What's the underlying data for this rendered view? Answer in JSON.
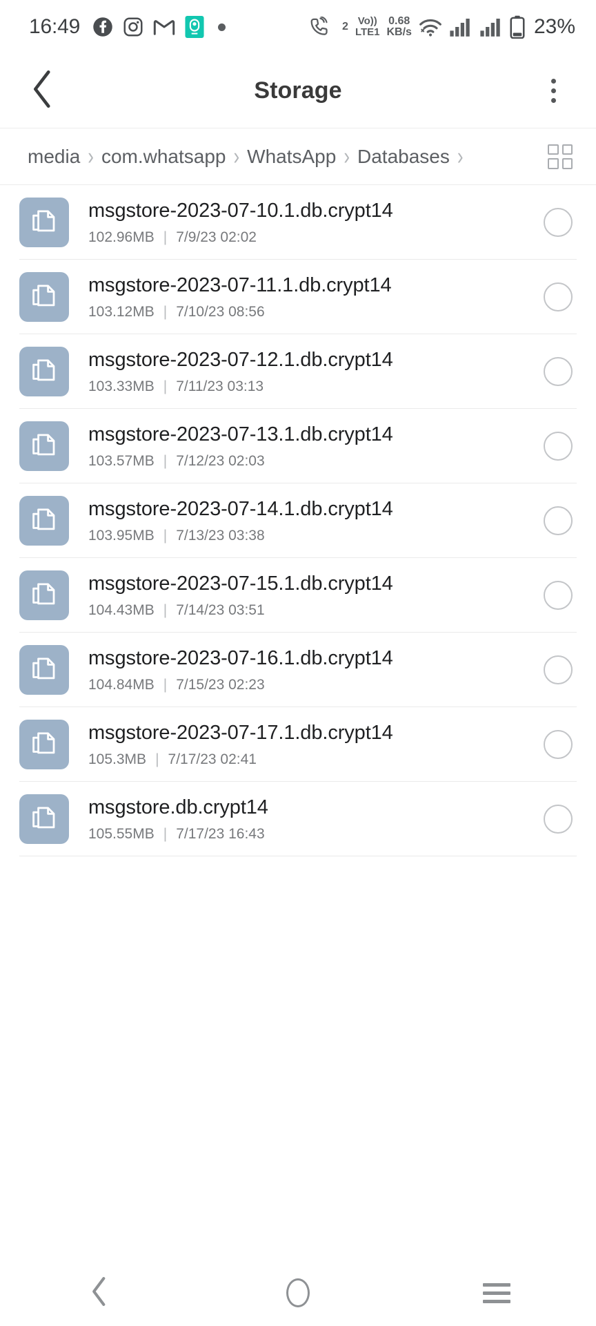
{
  "status_bar": {
    "clock": "16:49",
    "app_icons": [
      "facebook-icon",
      "instagram-icon",
      "gmail-icon",
      "teal-app-icon",
      "dot-indicator-icon"
    ],
    "network_badge": "2",
    "volte_line1": "Vo))",
    "volte_line2": "LTE1",
    "data_rate_value": "0.68",
    "data_rate_unit": "KB/s",
    "wifi": "wifi-icon",
    "signal_1": "signal-bars-icon",
    "signal_2": "signal-bars-icon",
    "battery_percent": "23%"
  },
  "app_bar": {
    "title": "Storage",
    "back_icon": "chevron-left-icon",
    "overflow_icon": "more-vertical-icon"
  },
  "breadcrumb": {
    "separator": "›",
    "crumbs": [
      {
        "label": "media"
      },
      {
        "label": "com.whatsapp"
      },
      {
        "label": "WhatsApp"
      },
      {
        "label": "Databases"
      }
    ],
    "grid_toggle_icon": "grid-view-icon"
  },
  "files": {
    "icon_name": "document-copy-icon",
    "icon_bg": "#9db2c8",
    "separator": "|",
    "items": [
      {
        "name": "msgstore-2023-07-10.1.db.crypt14",
        "size": "102.96MB",
        "date": "7/9/23 02:02",
        "selected": false
      },
      {
        "name": "msgstore-2023-07-11.1.db.crypt14",
        "size": "103.12MB",
        "date": "7/10/23 08:56",
        "selected": false
      },
      {
        "name": "msgstore-2023-07-12.1.db.crypt14",
        "size": "103.33MB",
        "date": "7/11/23 03:13",
        "selected": false
      },
      {
        "name": "msgstore-2023-07-13.1.db.crypt14",
        "size": "103.57MB",
        "date": "7/12/23 02:03",
        "selected": false
      },
      {
        "name": "msgstore-2023-07-14.1.db.crypt14",
        "size": "103.95MB",
        "date": "7/13/23 03:38",
        "selected": false
      },
      {
        "name": "msgstore-2023-07-15.1.db.crypt14",
        "size": "104.43MB",
        "date": "7/14/23 03:51",
        "selected": false
      },
      {
        "name": "msgstore-2023-07-16.1.db.crypt14",
        "size": "104.84MB",
        "date": "7/15/23 02:23",
        "selected": false
      },
      {
        "name": "msgstore-2023-07-17.1.db.crypt14",
        "size": "105.3MB",
        "date": "7/17/23 02:41",
        "selected": false
      },
      {
        "name": "msgstore.db.crypt14",
        "size": "105.55MB",
        "date": "7/17/23 16:43",
        "selected": false
      }
    ]
  },
  "nav_bar": {
    "back_icon": "chevron-left-icon",
    "home_icon": "home-circle-icon",
    "recents_icon": "recents-menu-icon"
  },
  "colors": {
    "accent_teal": "#12c7b0",
    "icon_blue_grey": "#9db2c8",
    "text_primary": "#1f2022",
    "text_secondary": "#77797c"
  }
}
